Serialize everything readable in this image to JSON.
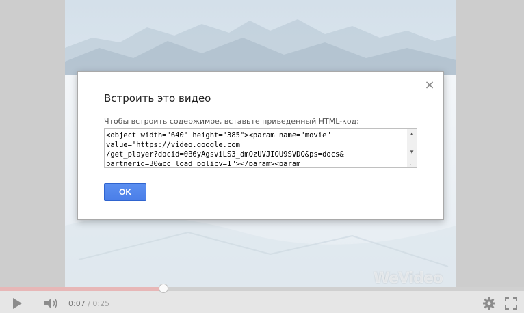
{
  "dialog": {
    "title": "Встроить это видео",
    "close_glyph": "×",
    "instruction": "Чтобы встроить содержимое, вставьте приведенный HTML-код:",
    "embed_code": "<object width=\"640\" height=\"385\"><param name=\"movie\"\nvalue=\"https://video.google.com\n/get_player?docid=0B6yAgsviLS3_dmQzUVJIOU9SVDQ&ps=docs&\npartnerid=30&cc_load_policy=1\"></param><param",
    "ok_label": "OK"
  },
  "player": {
    "current_time": "0:07",
    "separator": "/",
    "duration": "0:25",
    "progress_fraction": 0.3125,
    "watermark": "WeVideo",
    "progress_color": "#e7b7b7",
    "accent_button_color": "#4a7ee8"
  },
  "icons": {
    "play": "play-icon",
    "volume": "volume-icon",
    "settings": "gear-icon",
    "fullscreen": "fullscreen-icon",
    "close": "close-icon"
  }
}
